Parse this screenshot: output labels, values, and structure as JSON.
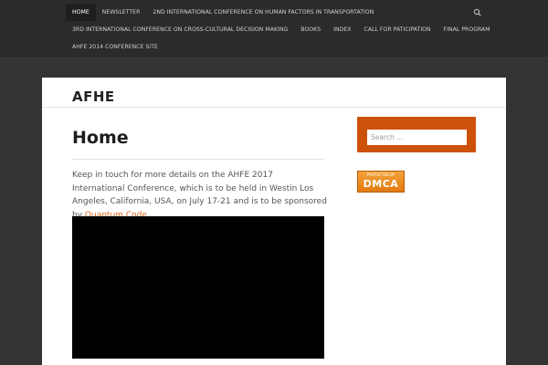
{
  "nav": {
    "row1": [
      "HOME",
      "NEWSLETTER",
      "2ND INTERNATIONAL CONFERENCE ON HUMAN FACTORS IN TRANSPORTATION"
    ],
    "row2": [
      "3RD INTERNATIONAL CONFERENCE ON CROSS-CULTURAL DECISION MAKING",
      "BOOKS",
      "INDEX",
      "CALL FOR PATICIPATION",
      "FINAL PROGRAM"
    ],
    "row3": [
      "AHFE 2014 CONFERENCE SITE"
    ],
    "active_index": 0,
    "search_icon": "search-icon"
  },
  "site": {
    "title": "AFHE"
  },
  "entry": {
    "title": "Home",
    "text_before_link": "Keep in touch for more details on the AHFE 2017 International Conference, which is to be held in Westin Los Angeles, California, USA, on July 17-21 and is to be sponsored by ",
    "link_text": "Quantum Code",
    "text_after_link": "."
  },
  "sidebar": {
    "search_placeholder": "Search ...",
    "dmca_top": "PROTECTED BY",
    "dmca_main": "DMCA"
  },
  "colors": {
    "accent": "#cc5209",
    "link": "#e0661c",
    "nav_bg": "#2b2b2b",
    "page_bg": "#333333"
  }
}
